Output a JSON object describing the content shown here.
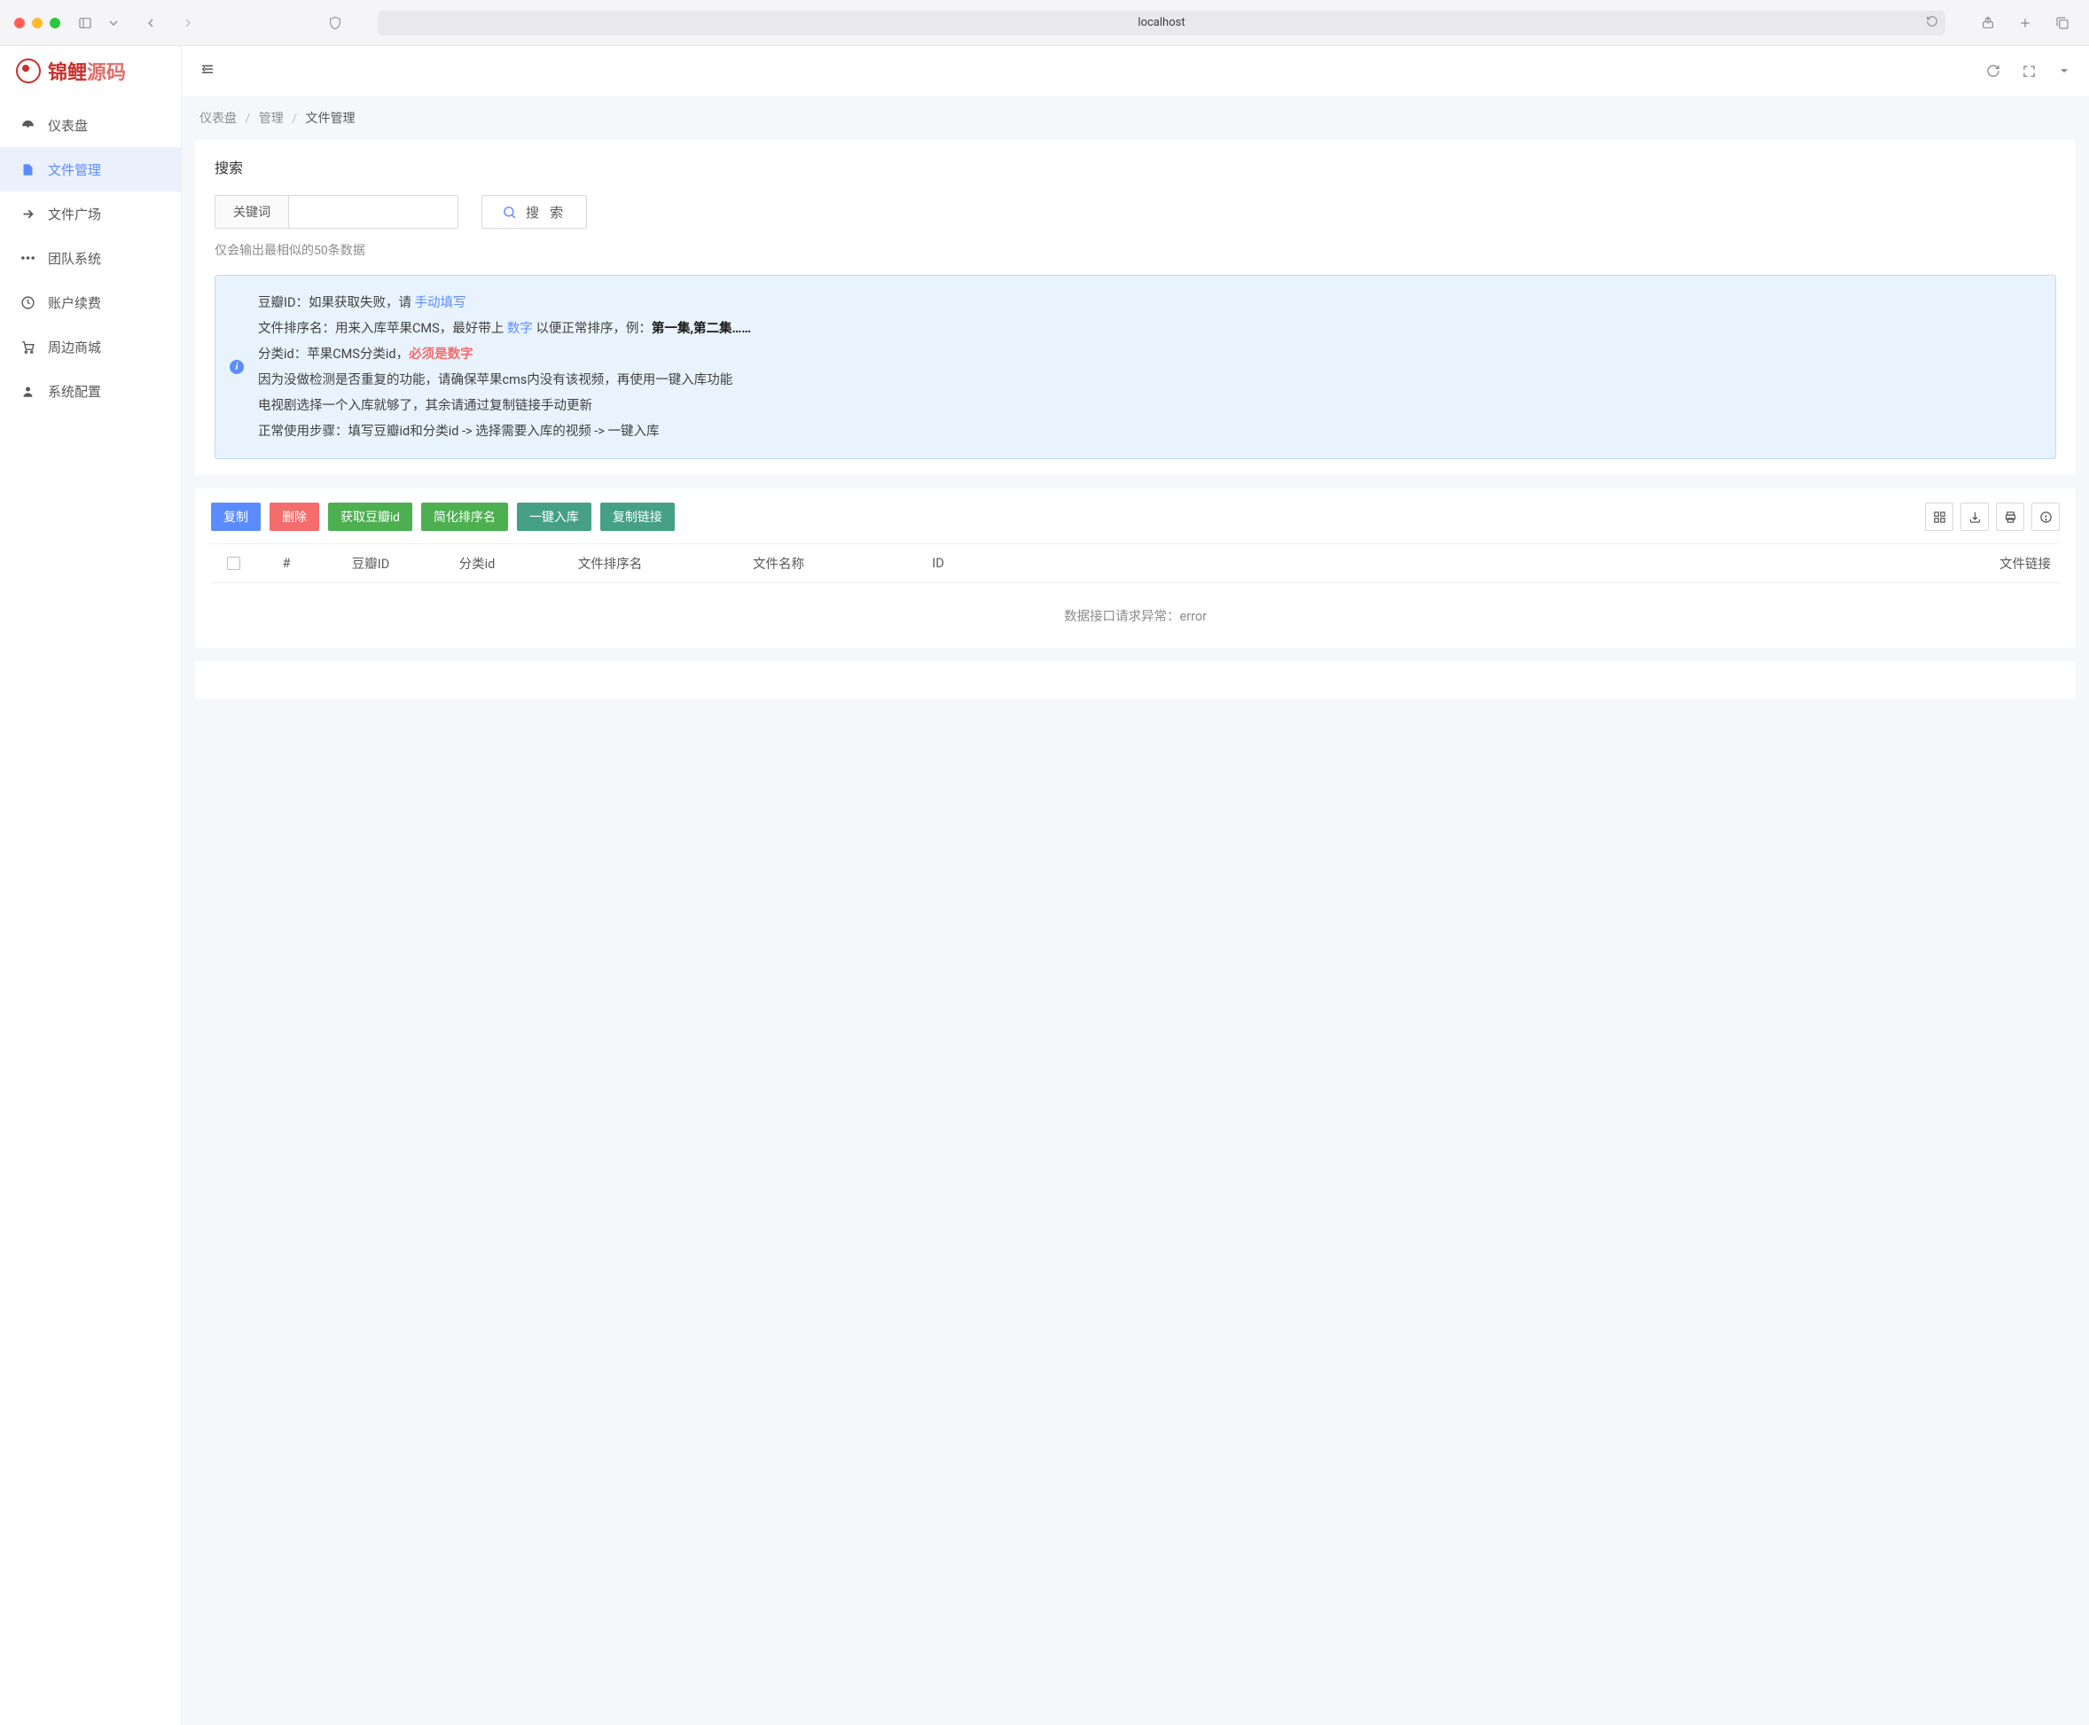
{
  "browser": {
    "url": "localhost"
  },
  "logo": {
    "part1": "锦鲤",
    "part2": "源码"
  },
  "nav": [
    {
      "label": "仪表盘"
    },
    {
      "label": "文件管理"
    },
    {
      "label": "文件广场"
    },
    {
      "label": "团队系统"
    },
    {
      "label": "账户续费"
    },
    {
      "label": "周边商城"
    },
    {
      "label": "系统配置"
    }
  ],
  "breadcrumb": {
    "a": "仪表盘",
    "b": "管理",
    "c": "文件管理"
  },
  "search": {
    "panel_title": "搜索",
    "addon": "关键词",
    "button": "搜 索",
    "hint": "仅会输出最相似的50条数据"
  },
  "info": {
    "l1a": "豆瓣ID：如果获取失败，请 ",
    "l1link": "手动填写",
    "l2a": "文件排序名：用来入库苹果CMS，最好带上 ",
    "l2link": "数字",
    "l2b": " 以便正常排序，例：",
    "l2bold": "第一集,第二集……",
    "l3a": "分类id：苹果CMS分类id，",
    "l3danger": "必须是数字",
    "l4": "因为没做检测是否重复的功能，请确保苹果cms内没有该视频，再使用一键入库功能",
    "l5": "电视剧选择一个入库就够了，其余请通过复制链接手动更新",
    "l6": "正常使用步骤：填写豆瓣id和分类id -> 选择需要入库的视频 -> 一键入库"
  },
  "buttons": {
    "copy": "复制",
    "delete": "删除",
    "get_douban": "获取豆瓣id",
    "simplify": "简化排序名",
    "one_click": "一键入库",
    "copy_link": "复制链接"
  },
  "columns": {
    "hash": "#",
    "douban": "豆瓣ID",
    "cat": "分类id",
    "sort": "文件排序名",
    "fname": "文件名称",
    "id": "ID",
    "link": "文件链接"
  },
  "error_msg": "数据接口请求异常：error"
}
